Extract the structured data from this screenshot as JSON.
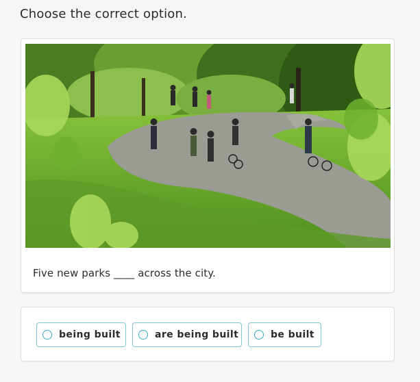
{
  "instruction": "Choose the correct option.",
  "question": {
    "image_icon": "park-photo",
    "sentence": "Five new parks ____ across the city."
  },
  "options": [
    {
      "label": "being built"
    },
    {
      "label": "are being built"
    },
    {
      "label": "be built"
    }
  ],
  "colors": {
    "option_border": "#7fc7d6",
    "radio_border": "#3aa8c1",
    "page_background": "#f6f6f6"
  }
}
